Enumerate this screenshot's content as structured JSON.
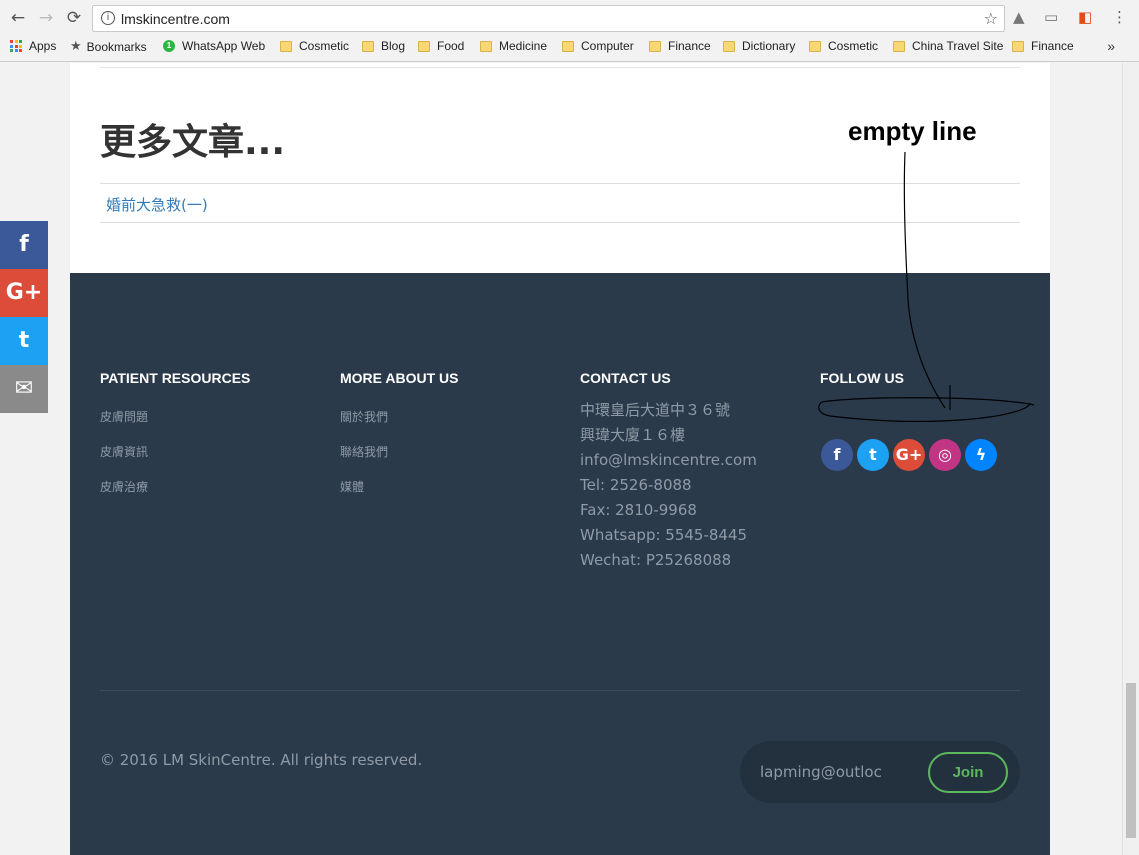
{
  "browser": {
    "url": "lmskincentre.com",
    "nav": {
      "back": "←",
      "forward": "→",
      "reload": "⟳"
    },
    "bookmarks": [
      {
        "label": "Apps",
        "icon": "apps-grid-icon"
      },
      {
        "label": "Bookmarks",
        "icon": "star-icon"
      },
      {
        "label": "WhatsApp Web",
        "icon": "whatsapp-icon"
      },
      {
        "label": "Cosmetic",
        "icon": "folder-icon"
      },
      {
        "label": "Blog",
        "icon": "folder-icon"
      },
      {
        "label": "Food",
        "icon": "folder-icon"
      },
      {
        "label": "Medicine",
        "icon": "folder-icon"
      },
      {
        "label": "Computer",
        "icon": "folder-icon"
      },
      {
        "label": "Finance",
        "icon": "folder-icon"
      },
      {
        "label": "Dictionary",
        "icon": "folder-icon"
      },
      {
        "label": "Cosmetic",
        "icon": "folder-icon"
      },
      {
        "label": "China Travel Site",
        "icon": "folder-icon"
      },
      {
        "label": "Finance",
        "icon": "folder-icon"
      }
    ],
    "more_bookmarks": "»"
  },
  "main": {
    "more_title": "更多文章...",
    "articles": [
      "婚前大急救(一)"
    ]
  },
  "footer": {
    "patient_resources": {
      "heading": "PATIENT RESOURCES",
      "links": [
        "皮膚問題",
        "皮膚資訊",
        "皮膚治療"
      ]
    },
    "more_about": {
      "heading": "MORE ABOUT US",
      "links": [
        "關於我們",
        "聯絡我們",
        "媒體"
      ]
    },
    "contact": {
      "heading": "CONTACT US",
      "lines": [
        "中環皇后大道中３６號",
        "興瑋大廈１６樓",
        "info@lmskincentre.com",
        "Tel: 2526-8088",
        "Fax: 2810-9968",
        "Whatsapp: 5545-8445",
        "Wechat: P25268088"
      ]
    },
    "follow": {
      "heading": "FOLLOW US",
      "icons": [
        {
          "name": "facebook-icon",
          "glyph": "f",
          "color": "#3b5998"
        },
        {
          "name": "twitter-icon",
          "glyph": "t",
          "color": "#1da1f2"
        },
        {
          "name": "google-plus-icon",
          "glyph": "G+",
          "color": "#dd4b39"
        },
        {
          "name": "instagram-icon",
          "glyph": "◎",
          "color": "#c13584"
        },
        {
          "name": "messenger-icon",
          "glyph": "ϟ",
          "color": "#0084ff"
        }
      ]
    },
    "copyright": "© 2016 LM SkinCentre. All rights reserved.",
    "newsletter": {
      "value": "lapming@outloc",
      "join_label": "Join"
    }
  },
  "share_bar": [
    {
      "name": "share-facebook-button",
      "glyph": "f",
      "color": "#3b5998"
    },
    {
      "name": "share-google-plus-button",
      "glyph": "G+",
      "color": "#dd4b39"
    },
    {
      "name": "share-twitter-button",
      "glyph": "t",
      "color": "#1da1f2"
    },
    {
      "name": "share-email-button",
      "glyph": "✉",
      "color": "#8a8a8a"
    }
  ],
  "annotation": {
    "label": "empty line"
  }
}
